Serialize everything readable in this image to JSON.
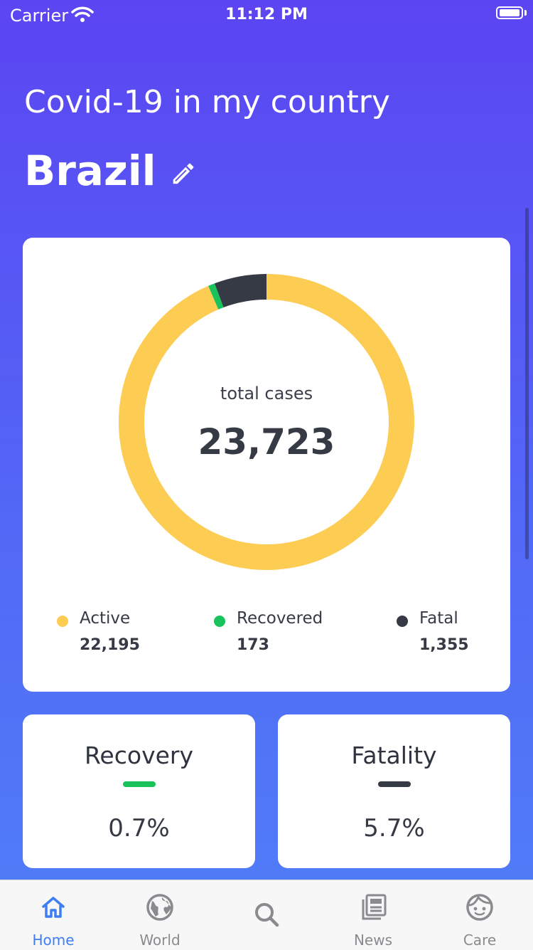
{
  "status_bar": {
    "carrier": "Carrier",
    "time": "11:12 PM"
  },
  "header": {
    "title": "Covid-19 in my country",
    "country": "Brazil"
  },
  "summary": {
    "total_label": "total cases",
    "total_value": "23,723",
    "legend": [
      {
        "label": "Active",
        "value": "22,195",
        "color": "#fccc53"
      },
      {
        "label": "Recovered",
        "value": "173",
        "color": "#19c35b"
      },
      {
        "label": "Fatal",
        "value": "1,355",
        "color": "#363a45"
      }
    ]
  },
  "chart_data": {
    "type": "pie",
    "categories": [
      "Active",
      "Recovered",
      "Fatal"
    ],
    "values": [
      22195,
      173,
      1355
    ],
    "colors": [
      "#fccc53",
      "#19c35b",
      "#363a45"
    ],
    "title": "total cases"
  },
  "stats": {
    "recovery": {
      "title": "Recovery",
      "value": "0.7%",
      "color": "#19c35b"
    },
    "fatality": {
      "title": "Fatality",
      "value": "5.7%",
      "color": "#363a45"
    }
  },
  "tabs": [
    {
      "label": "Home",
      "icon": "home-icon",
      "active": true
    },
    {
      "label": "World",
      "icon": "globe-icon",
      "active": false
    },
    {
      "label": "",
      "icon": "search-icon",
      "active": false
    },
    {
      "label": "News",
      "icon": "news-icon",
      "active": false
    },
    {
      "label": "Care",
      "icon": "care-face-icon",
      "active": false
    }
  ],
  "colors": {
    "accent": "#3f7df3",
    "gradient_top": "#5b45f2",
    "gradient_bottom": "#4f7ff7"
  }
}
